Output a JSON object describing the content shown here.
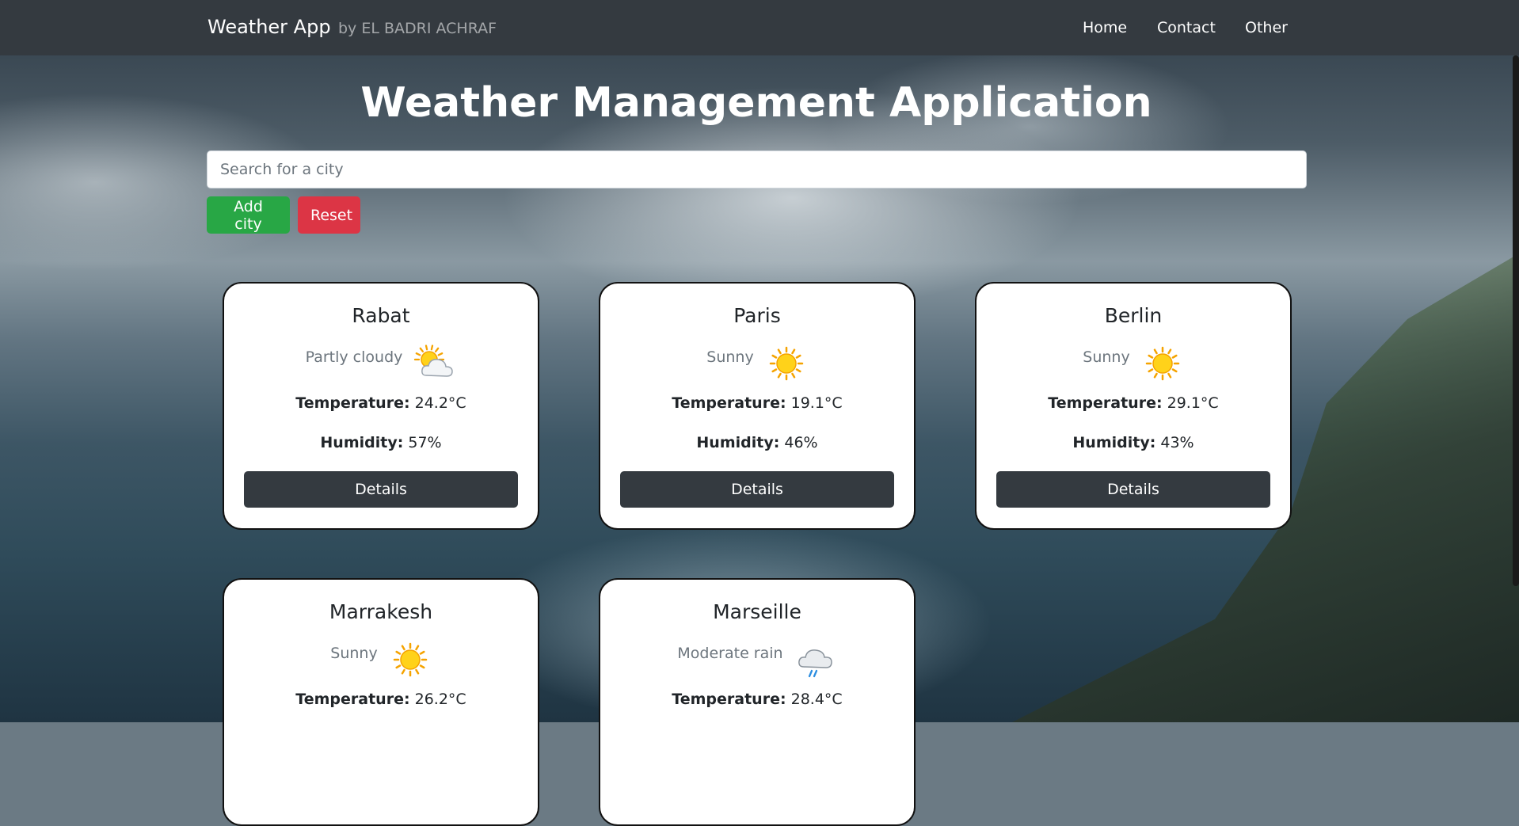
{
  "navbar": {
    "brand": "Weather App",
    "byline": "by EL BADRI ACHRAF",
    "links": [
      "Home",
      "Contact",
      "Other"
    ]
  },
  "page": {
    "title": "Weather Management Application"
  },
  "search": {
    "placeholder": "Search for a city",
    "value": ""
  },
  "actions": {
    "add_label": "Add city",
    "reset_label": "Reset"
  },
  "labels": {
    "temperature": "Temperature:",
    "humidity": "Humidity:",
    "details": "Details"
  },
  "cities": [
    {
      "name": "Rabat",
      "condition": "Partly cloudy",
      "icon": "partly-cloudy-icon",
      "temperature": "24.2°C",
      "humidity": "57%"
    },
    {
      "name": "Paris",
      "condition": "Sunny",
      "icon": "sun-icon",
      "temperature": "19.1°C",
      "humidity": "46%"
    },
    {
      "name": "Berlin",
      "condition": "Sunny",
      "icon": "sun-icon",
      "temperature": "29.1°C",
      "humidity": "43%"
    },
    {
      "name": "Marrakesh",
      "condition": "Sunny",
      "icon": "sun-icon",
      "temperature": "26.2°C",
      "humidity": ""
    },
    {
      "name": "Marseille",
      "condition": "Moderate rain",
      "icon": "rain-cloud-icon",
      "temperature": "28.4°C",
      "humidity": ""
    }
  ],
  "colors": {
    "navbar": "#343a40",
    "success": "#28a745",
    "danger": "#dc3545",
    "details_button": "#343a40"
  }
}
